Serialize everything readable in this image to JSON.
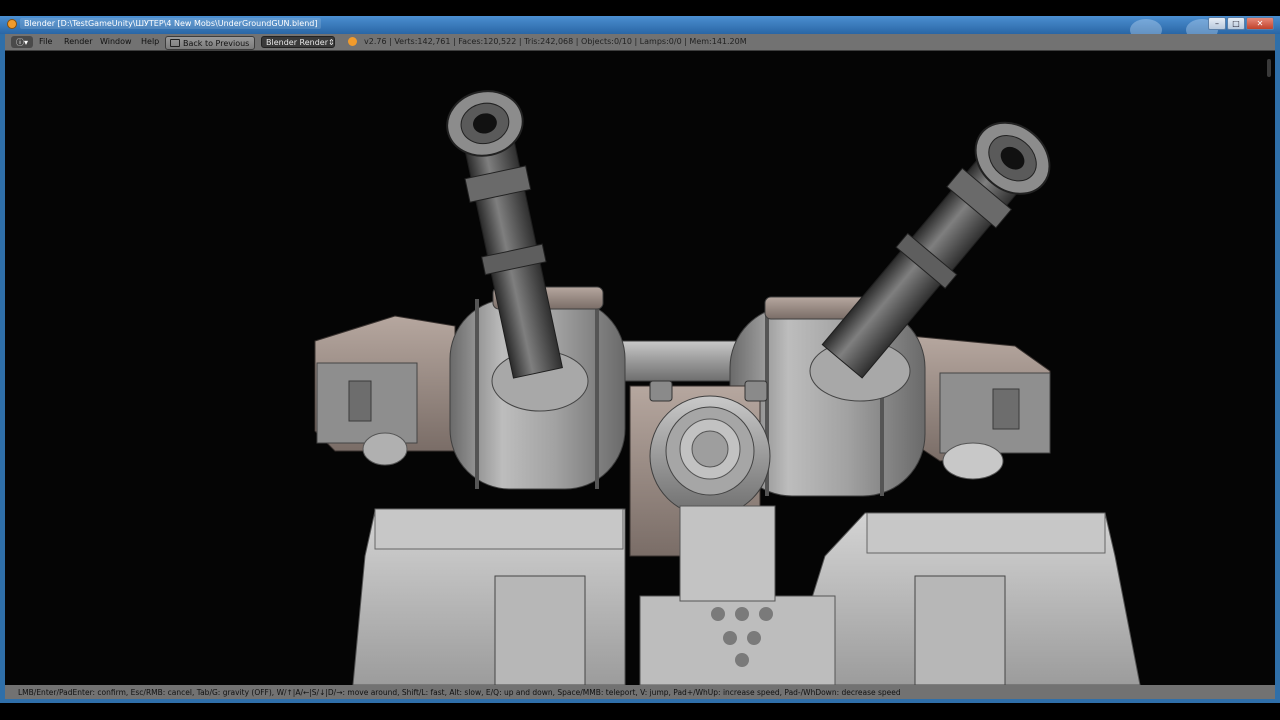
{
  "window": {
    "title": "Blender [D:\\TestGameUnity\\ШУТЕР\\4 New Mobs\\UnderGroundGUN.blend]",
    "controls": {
      "minimize": "–",
      "maximize": "□",
      "close": "✕"
    }
  },
  "header": {
    "editor_type_icon": "info-editor-icon",
    "menus": [
      "File",
      "Render",
      "Window",
      "Help"
    ],
    "back_button": "Back to Previous",
    "render_engine": "Blender Render",
    "stats": "v2.76 | Verts:142,761 | Faces:120,522 | Tris:242,068 | Objects:0/10 | Lamps:0/0 | Mem:141.20M"
  },
  "status": {
    "text": "LMB/Enter/PadEnter: confirm, Esc/RMB: cancel, Tab/G: gravity (OFF), W/↑|A/←|S/↓|D/→: move around, Shift/L: fast, Alt: slow, E/Q: up and down, Space/MMB: teleport, V: jump, Pad+/WhUp: increase speed, Pad-/WhDown: decrease speed"
  },
  "colors": {
    "titlebar": "#2f6fa9",
    "header": "#727272",
    "viewport": "#050505",
    "accent": "#f19b2c"
  }
}
